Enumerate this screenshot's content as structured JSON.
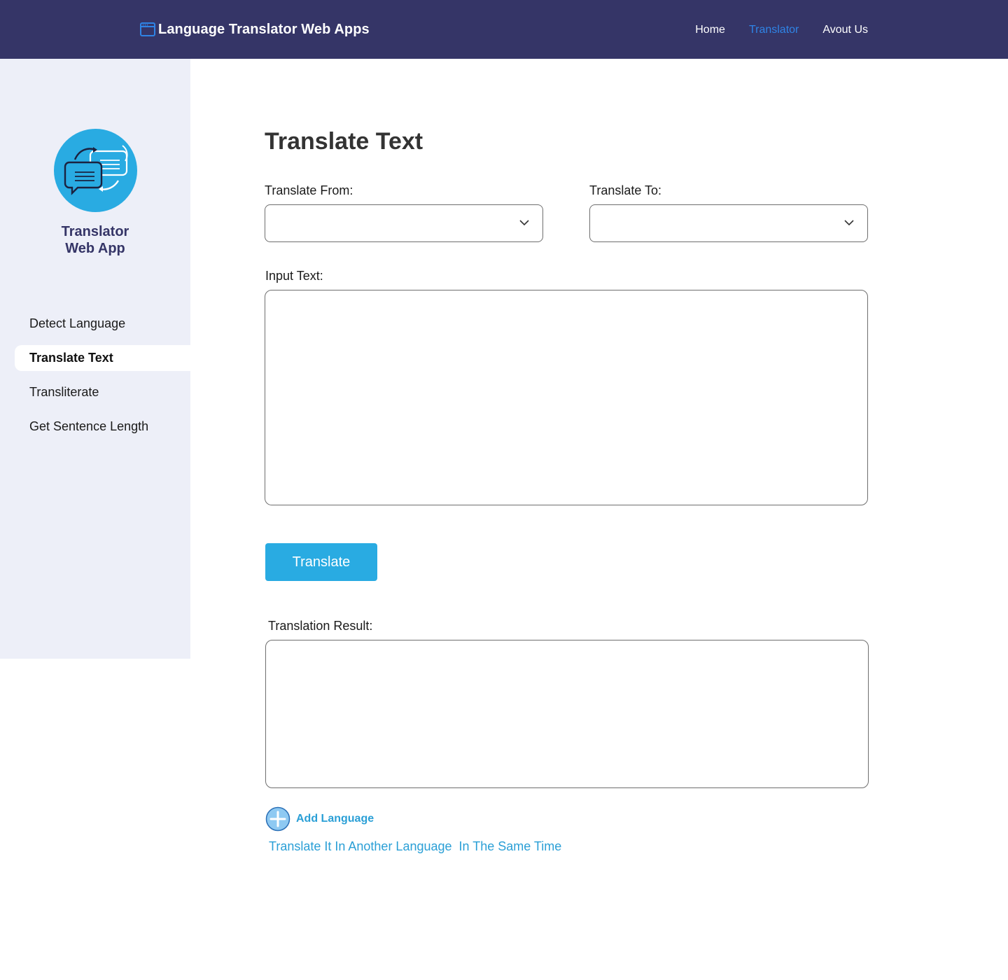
{
  "header": {
    "brand_icon": "browser-window-icon",
    "title": "Language Translator Web Apps",
    "nav": [
      {
        "label": "Home",
        "active": false
      },
      {
        "label": "Translator",
        "active": true
      },
      {
        "label": "Avout Us",
        "active": false
      }
    ],
    "colors": {
      "background": "#353567",
      "active_link": "#2f84e6"
    }
  },
  "sidebar": {
    "logo_icon": "chat-bubbles-translate-icon",
    "logo_line1": "Translator",
    "logo_line2": "Web App",
    "items": [
      {
        "label": "Detect Language",
        "active": false
      },
      {
        "label": "Translate Text",
        "active": true
      },
      {
        "label": "Transliterate",
        "active": false
      },
      {
        "label": "Get Sentence Length",
        "active": false
      }
    ],
    "colors": {
      "background": "#edeff8",
      "accent": "#29abe2"
    }
  },
  "main": {
    "title": "Translate Text",
    "translate_from_label": "Translate From:",
    "translate_from_value": "",
    "translate_to_label": "Translate To:",
    "translate_to_value": "",
    "input_label": "Input Text:",
    "input_value": "",
    "translate_button": "Translate",
    "result_label": "Translation Result:",
    "result_value": "",
    "add_language_label": "Add Language",
    "add_language_icon": "plus-circle-icon",
    "add_language_hint": "Translate It In Another Language  In The Same Time",
    "colors": {
      "button": "#29abe2",
      "link": "#2a9fd6"
    }
  }
}
